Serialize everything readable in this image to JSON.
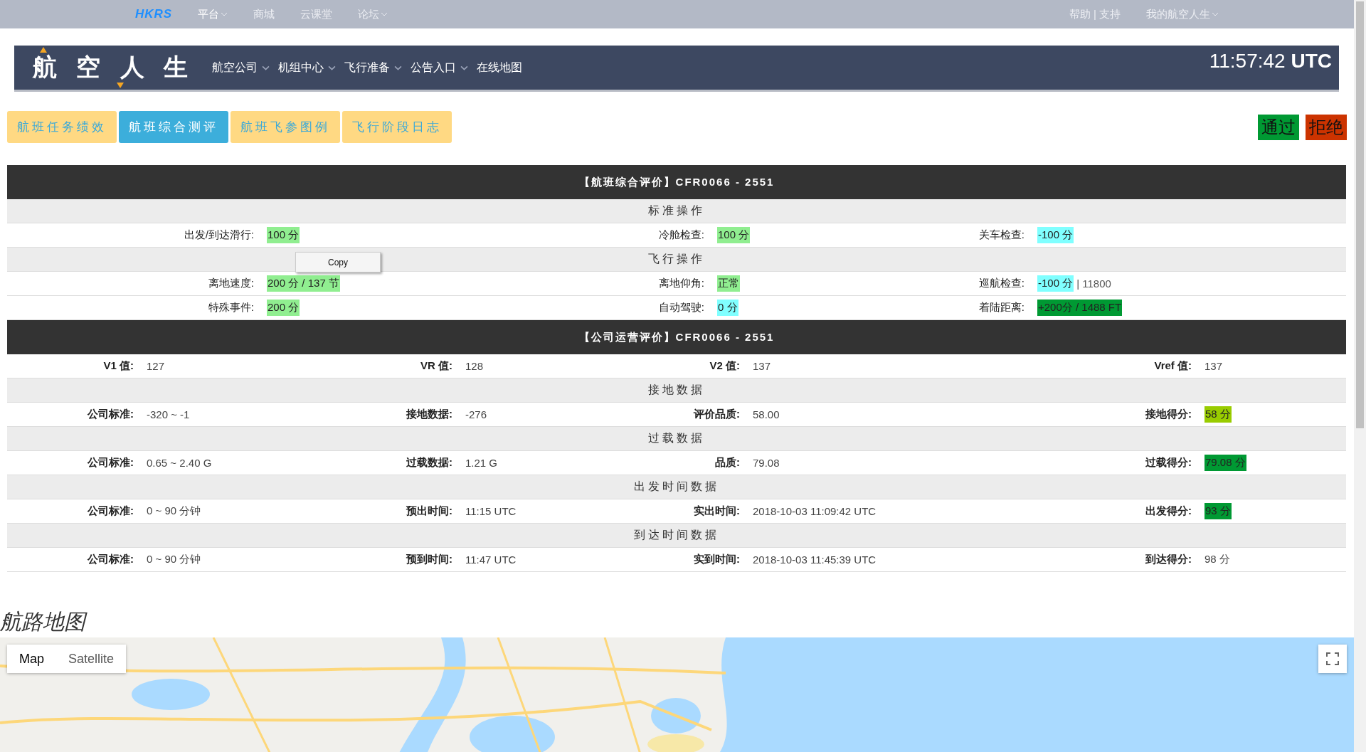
{
  "top_nav": {
    "logo": "HKRS",
    "items": [
      {
        "label": "平台",
        "has_menu": true,
        "selected": true
      },
      {
        "label": "商城",
        "has_menu": false,
        "selected": false
      },
      {
        "label": "云课堂",
        "has_menu": false,
        "selected": false
      },
      {
        "label": "论坛",
        "has_menu": true,
        "selected": false
      }
    ],
    "right_items": [
      {
        "label": "帮助 | 支持",
        "has_menu": false
      },
      {
        "label": "我的航空人生",
        "has_menu": true
      }
    ]
  },
  "header": {
    "logo": "航 空 人 生",
    "menu": [
      {
        "label": "航空公司",
        "has_menu": true
      },
      {
        "label": "机组中心",
        "has_menu": true
      },
      {
        "label": "飞行准备",
        "has_menu": true
      },
      {
        "label": "公告入口",
        "has_menu": true
      },
      {
        "label": "在线地图",
        "has_menu": false
      }
    ],
    "clock": "11:57:42 **UTC**"
  },
  "tabs": [
    {
      "label": "航班任务绩效",
      "selected": false
    },
    {
      "label": "航班综合测评",
      "selected": true
    },
    {
      "label": "航班飞参图例",
      "selected": false
    },
    {
      "label": "飞行阶段日志",
      "selected": false
    }
  ],
  "actions": [
    {
      "label": "通过",
      "kind": "approve"
    },
    {
      "label": "拒绝",
      "kind": "reject"
    }
  ],
  "context_menu": {
    "items": [
      "Copy"
    ]
  },
  "panels": [
    {
      "title": "【航班综合评价】CFR0066 - 2551",
      "kind": "three_column",
      "rows": [
        {
          "kind": "section",
          "title": "标准操作"
        },
        {
          "kind": "data",
          "cells": [
            {
              "label": "出发/到达滑行:",
              "value": "100 分",
              "color": "#90ee90"
            },
            {
              "label": "冷舱检查:",
              "value": "100 分",
              "color": "#90ee90"
            },
            {
              "label": "关车检查:",
              "value": "-100 分",
              "color": "#80ffff"
            }
          ]
        },
        {
          "kind": "section",
          "title": "飞行操作"
        },
        {
          "kind": "data",
          "cells": [
            {
              "label": "离地速度:",
              "value": "200 分 / 137 节",
              "color": "#90ee90"
            },
            {
              "label": "离地仰角:",
              "value": "正常",
              "color": "#90ee90"
            },
            {
              "label": "巡航检查:",
              "value": "-100 分",
              "color": "#80ffff",
              "note": "| 11800"
            }
          ]
        },
        {
          "kind": "data",
          "cells": [
            {
              "label": "特殊事件:",
              "value": "200 分",
              "color": "#90ee90"
            },
            {
              "label": "自动驾驶:",
              "value": "0 分",
              "color": "#80ffff"
            },
            {
              "label": "着陆距离:",
              "value": "+200分 / 1488 FT",
              "color": "#009933"
            }
          ]
        }
      ]
    },
    {
      "title": "【公司运营评价】CFR0066 - 2551",
      "kind": "four_column",
      "rows": [
        {
          "kind": "data",
          "cells": [
            {
              "label": "V1 值:",
              "value": "127"
            },
            {
              "label": "VR 值:",
              "value": "128"
            },
            {
              "label": "V2 值:",
              "value": "137"
            },
            {
              "label": "Vref 值:",
              "value": "137"
            }
          ]
        },
        {
          "kind": "section",
          "title": "接地数据"
        },
        {
          "kind": "data",
          "cells": [
            {
              "label": "公司标准:",
              "value": "-320 ~ -1"
            },
            {
              "label": "接地数据:",
              "value": "-276"
            },
            {
              "label": "评价品质:",
              "value": "58.00"
            },
            {
              "label": "接地得分:",
              "value": "58 分",
              "color": "#99cc00"
            }
          ]
        },
        {
          "kind": "section",
          "title": "过载数据"
        },
        {
          "kind": "data",
          "cells": [
            {
              "label": "公司标准:",
              "value": "0.65 ~ 2.40 G"
            },
            {
              "label": "过载数据:",
              "value": "1.21 G"
            },
            {
              "label": "品质:",
              "value": "79.08"
            },
            {
              "label": "过载得分:",
              "value": "79.08 分",
              "color": "#009933"
            }
          ]
        },
        {
          "kind": "section",
          "title": "出发时间数据"
        },
        {
          "kind": "data",
          "cells": [
            {
              "label": "公司标准:",
              "value": "0 ~ 90 分钟"
            },
            {
              "label": "预出时间:",
              "value": "11:15 UTC"
            },
            {
              "label": "实出时间:",
              "value": "2018-10-03 11:09:42 UTC"
            },
            {
              "label": "出发得分:",
              "value": "93 分",
              "color": "#009933"
            }
          ]
        },
        {
          "kind": "section",
          "title": "到达时间数据"
        },
        {
          "kind": "data",
          "cells": [
            {
              "label": "公司标准:",
              "value": "0 ~ 90 分钟"
            },
            {
              "label": "预到时间:",
              "value": "11:47 UTC"
            },
            {
              "label": "实到时间:",
              "value": "2018-10-03 11:45:39 UTC"
            },
            {
              "label": "到达得分:",
              "value": "98 分"
            }
          ]
        }
      ]
    }
  ],
  "map": {
    "title": "航路地图",
    "types": [
      {
        "label": "Map",
        "selected": true
      },
      {
        "label": "Satellite",
        "selected": false
      }
    ],
    "kind": "picture"
  }
}
